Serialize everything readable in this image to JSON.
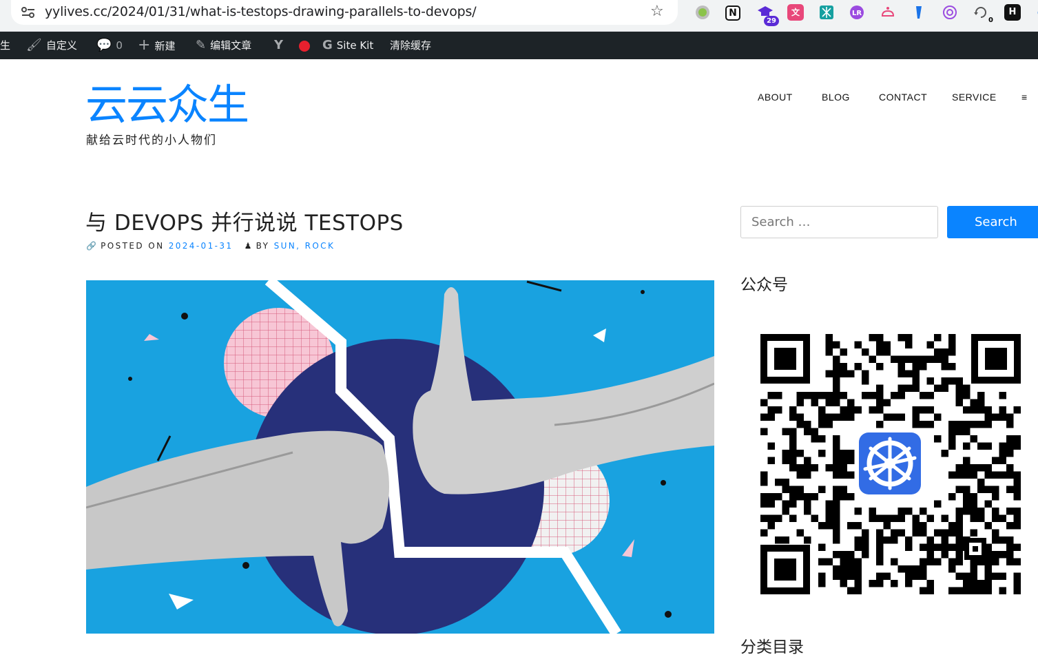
{
  "browser": {
    "url": "yylives.cc/2024/01/31/what-is-testops-drawing-parallels-to-devops/",
    "extensions": [
      {
        "name": "circle-extension-icon",
        "badge": ""
      },
      {
        "name": "notion-extension-icon",
        "glyph": "N",
        "badge": ""
      },
      {
        "name": "grad-cap-extension-icon",
        "badge": "29"
      },
      {
        "name": "translate-extension-icon",
        "badge": ""
      },
      {
        "name": "grid-extension-icon",
        "badge": ""
      },
      {
        "name": "purple-extension-icon",
        "badge": ""
      },
      {
        "name": "cloud-extension-icon",
        "badge": ""
      },
      {
        "name": "feather-extension-icon",
        "badge": ""
      },
      {
        "name": "openai-extension-icon",
        "badge": ""
      },
      {
        "name": "refresh-extension-icon",
        "count": "0"
      },
      {
        "name": "h-extension-icon",
        "badge": ""
      }
    ]
  },
  "adminbar": {
    "site_fragment": "生",
    "customize": "自定义",
    "comments_count": "0",
    "new": "新建",
    "edit_post": "编辑文章",
    "site_kit": "Site Kit",
    "clear_cache": "清除缓存"
  },
  "site": {
    "title": "云云众生",
    "description": "献给云时代的小人物们"
  },
  "nav": {
    "items": [
      "ABOUT",
      "BLOG",
      "CONTACT",
      "SERVICE"
    ],
    "menu_glyph": "≡"
  },
  "post": {
    "title": "与 DEVOPS 并行说说 TESTOPS",
    "posted_on_label": "POSTED ON",
    "date": "2024-01-31",
    "by_label": "BY",
    "authors": "SUN, ROCK"
  },
  "sidebar": {
    "search_placeholder": "Search …",
    "search_button": "Search",
    "widget_title": "公众号",
    "widget_title_2": "分类目录"
  },
  "colors": {
    "accent": "#0a84ff",
    "adminbar_bg": "#1d2327",
    "hero_bg": "#1aa3e3",
    "hero_circle": "#27307a"
  }
}
